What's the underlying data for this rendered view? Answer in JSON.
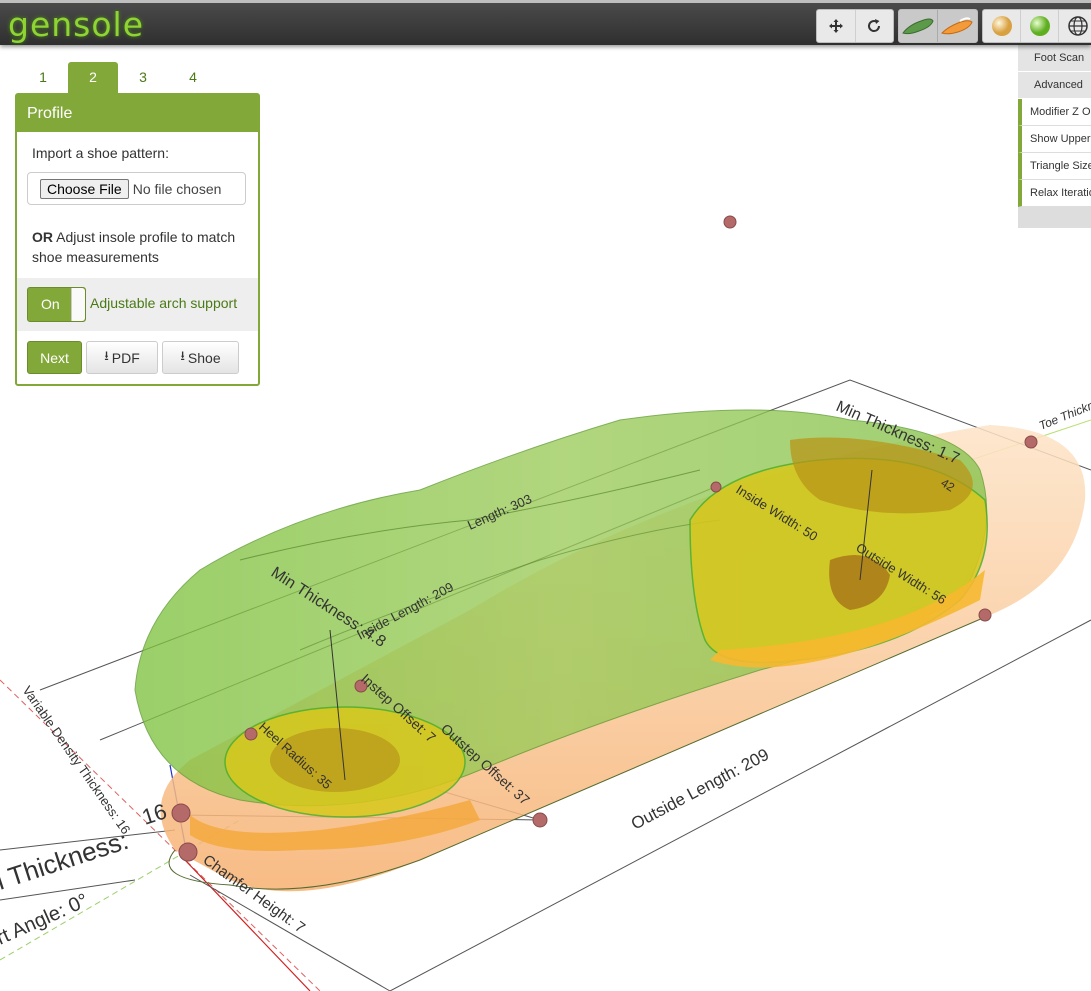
{
  "app": {
    "logo": "gensole"
  },
  "toolbar": {
    "groups": [
      [
        "move-icon",
        "refresh-icon"
      ],
      [
        "green-insole-icon",
        "orange-insole-icon"
      ],
      [
        "beige-sphere-icon",
        "green-sphere-icon",
        "globe-icon"
      ]
    ]
  },
  "tabs": [
    "1",
    "2",
    "3",
    "4"
  ],
  "active_tab": "2",
  "panel": {
    "title": "Profile",
    "import_label": "Import a shoe pattern:",
    "choose_file_label": "Choose File",
    "no_file_text": "No file chosen",
    "or_bold": "OR",
    "or_text": "Adjust insole profile to match shoe measurements",
    "toggle_label": "On",
    "arch_label": "Adjustable arch support",
    "next_label": "Next",
    "pdf_label": "PDF",
    "shoe_label": "Shoe"
  },
  "right_panel": {
    "headers": [
      "Foot Scan",
      "Advanced"
    ],
    "items": [
      "Modifier Z O",
      "Show Upper",
      "Triangle Size",
      "Relax Iteratio"
    ]
  },
  "viewport": {
    "labels": {
      "length": "Length: 303",
      "inside_length": "Inside Length: 209",
      "outside_length": "Outside Length: 209",
      "min_thickness_heel": "Min Thickness: 4.8",
      "min_thickness_toe": "Min Thickness: 1.7",
      "inside_width": "Inside Width: 50",
      "outside_width": "Outside Width: 56",
      "instep_offset": "Instep Offset: 7",
      "outstep_offset": "Outstep Offset: 37",
      "heel_radius": "Heel Radius: 35",
      "variable_density": "Variable Density Thickness: 16",
      "chamfer_height": "Chamfer Height: 7",
      "heel_thickness": "l Thickness:",
      "heel_thickness_val": "16",
      "support_angle": "rt Angle: 0°",
      "toe_thickness": "Toe Thickne",
      "val_42": "42"
    },
    "colors": {
      "insole": "#f8c08a",
      "foot": "#6fc13a",
      "pad": "#e8c21a",
      "accent": "#83a83a"
    }
  }
}
